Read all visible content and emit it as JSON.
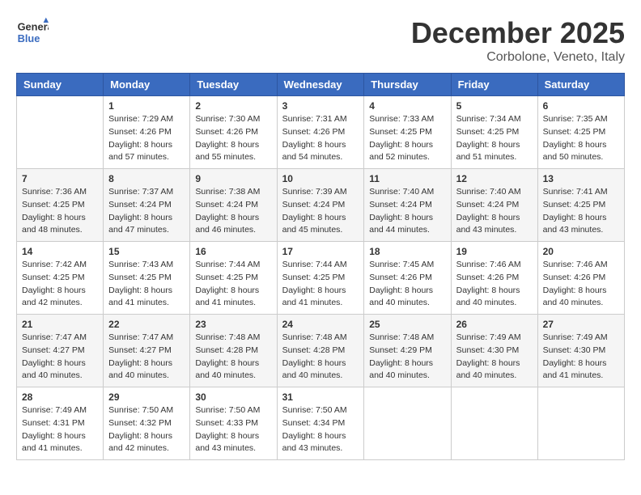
{
  "header": {
    "logo_line1": "General",
    "logo_line2": "Blue",
    "month": "December 2025",
    "location": "Corbolone, Veneto, Italy"
  },
  "weekdays": [
    "Sunday",
    "Monday",
    "Tuesday",
    "Wednesday",
    "Thursday",
    "Friday",
    "Saturday"
  ],
  "weeks": [
    [
      {
        "day": "",
        "info": ""
      },
      {
        "day": "1",
        "info": "Sunrise: 7:29 AM\nSunset: 4:26 PM\nDaylight: 8 hours\nand 57 minutes."
      },
      {
        "day": "2",
        "info": "Sunrise: 7:30 AM\nSunset: 4:26 PM\nDaylight: 8 hours\nand 55 minutes."
      },
      {
        "day": "3",
        "info": "Sunrise: 7:31 AM\nSunset: 4:26 PM\nDaylight: 8 hours\nand 54 minutes."
      },
      {
        "day": "4",
        "info": "Sunrise: 7:33 AM\nSunset: 4:25 PM\nDaylight: 8 hours\nand 52 minutes."
      },
      {
        "day": "5",
        "info": "Sunrise: 7:34 AM\nSunset: 4:25 PM\nDaylight: 8 hours\nand 51 minutes."
      },
      {
        "day": "6",
        "info": "Sunrise: 7:35 AM\nSunset: 4:25 PM\nDaylight: 8 hours\nand 50 minutes."
      }
    ],
    [
      {
        "day": "7",
        "info": "Sunrise: 7:36 AM\nSunset: 4:25 PM\nDaylight: 8 hours\nand 48 minutes."
      },
      {
        "day": "8",
        "info": "Sunrise: 7:37 AM\nSunset: 4:24 PM\nDaylight: 8 hours\nand 47 minutes."
      },
      {
        "day": "9",
        "info": "Sunrise: 7:38 AM\nSunset: 4:24 PM\nDaylight: 8 hours\nand 46 minutes."
      },
      {
        "day": "10",
        "info": "Sunrise: 7:39 AM\nSunset: 4:24 PM\nDaylight: 8 hours\nand 45 minutes."
      },
      {
        "day": "11",
        "info": "Sunrise: 7:40 AM\nSunset: 4:24 PM\nDaylight: 8 hours\nand 44 minutes."
      },
      {
        "day": "12",
        "info": "Sunrise: 7:40 AM\nSunset: 4:24 PM\nDaylight: 8 hours\nand 43 minutes."
      },
      {
        "day": "13",
        "info": "Sunrise: 7:41 AM\nSunset: 4:25 PM\nDaylight: 8 hours\nand 43 minutes."
      }
    ],
    [
      {
        "day": "14",
        "info": "Sunrise: 7:42 AM\nSunset: 4:25 PM\nDaylight: 8 hours\nand 42 minutes."
      },
      {
        "day": "15",
        "info": "Sunrise: 7:43 AM\nSunset: 4:25 PM\nDaylight: 8 hours\nand 41 minutes."
      },
      {
        "day": "16",
        "info": "Sunrise: 7:44 AM\nSunset: 4:25 PM\nDaylight: 8 hours\nand 41 minutes."
      },
      {
        "day": "17",
        "info": "Sunrise: 7:44 AM\nSunset: 4:25 PM\nDaylight: 8 hours\nand 41 minutes."
      },
      {
        "day": "18",
        "info": "Sunrise: 7:45 AM\nSunset: 4:26 PM\nDaylight: 8 hours\nand 40 minutes."
      },
      {
        "day": "19",
        "info": "Sunrise: 7:46 AM\nSunset: 4:26 PM\nDaylight: 8 hours\nand 40 minutes."
      },
      {
        "day": "20",
        "info": "Sunrise: 7:46 AM\nSunset: 4:26 PM\nDaylight: 8 hours\nand 40 minutes."
      }
    ],
    [
      {
        "day": "21",
        "info": "Sunrise: 7:47 AM\nSunset: 4:27 PM\nDaylight: 8 hours\nand 40 minutes."
      },
      {
        "day": "22",
        "info": "Sunrise: 7:47 AM\nSunset: 4:27 PM\nDaylight: 8 hours\nand 40 minutes."
      },
      {
        "day": "23",
        "info": "Sunrise: 7:48 AM\nSunset: 4:28 PM\nDaylight: 8 hours\nand 40 minutes."
      },
      {
        "day": "24",
        "info": "Sunrise: 7:48 AM\nSunset: 4:28 PM\nDaylight: 8 hours\nand 40 minutes."
      },
      {
        "day": "25",
        "info": "Sunrise: 7:48 AM\nSunset: 4:29 PM\nDaylight: 8 hours\nand 40 minutes."
      },
      {
        "day": "26",
        "info": "Sunrise: 7:49 AM\nSunset: 4:30 PM\nDaylight: 8 hours\nand 40 minutes."
      },
      {
        "day": "27",
        "info": "Sunrise: 7:49 AM\nSunset: 4:30 PM\nDaylight: 8 hours\nand 41 minutes."
      }
    ],
    [
      {
        "day": "28",
        "info": "Sunrise: 7:49 AM\nSunset: 4:31 PM\nDaylight: 8 hours\nand 41 minutes."
      },
      {
        "day": "29",
        "info": "Sunrise: 7:50 AM\nSunset: 4:32 PM\nDaylight: 8 hours\nand 42 minutes."
      },
      {
        "day": "30",
        "info": "Sunrise: 7:50 AM\nSunset: 4:33 PM\nDaylight: 8 hours\nand 43 minutes."
      },
      {
        "day": "31",
        "info": "Sunrise: 7:50 AM\nSunset: 4:34 PM\nDaylight: 8 hours\nand 43 minutes."
      },
      {
        "day": "",
        "info": ""
      },
      {
        "day": "",
        "info": ""
      },
      {
        "day": "",
        "info": ""
      }
    ]
  ]
}
